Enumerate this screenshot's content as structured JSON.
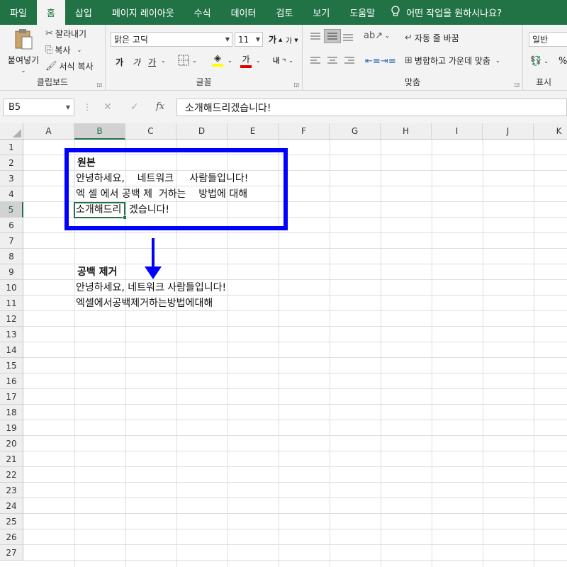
{
  "menu": {
    "tabs": [
      "파일",
      "홈",
      "삽입",
      "페이지 레이아웃",
      "수식",
      "데이터",
      "검토",
      "보기",
      "도움말"
    ],
    "active_tab": "홈",
    "tell_me": "어떤 작업을 원하시나요?"
  },
  "ribbon": {
    "clipboard": {
      "paste": "붙여넣기",
      "cut": "잘라내기",
      "copy": "복사",
      "format_painter": "서식 복사",
      "label": "클립보드"
    },
    "font": {
      "name": "맑은 고딕",
      "size": "11",
      "bold": "가",
      "italic": "가",
      "underline": "가",
      "font_color": "가",
      "label": "글꼴"
    },
    "alignment": {
      "wrap_text": "자동 줄 바꿈",
      "merge_center": "병합하고 가운데 맞춤",
      "label": "맞춤"
    },
    "number": {
      "format": "일반",
      "label": "표시"
    }
  },
  "formula_bar": {
    "name_box": "B5",
    "fx": "fx",
    "content": "소개해드리겠습니다!"
  },
  "columns": [
    "A",
    "B",
    "C",
    "D",
    "E",
    "F",
    "G",
    "H",
    "I",
    "J",
    "K"
  ],
  "rows": [
    "1",
    "2",
    "3",
    "4",
    "5",
    "6",
    "7",
    "8",
    "9",
    "10",
    "11",
    "12",
    "13",
    "14",
    "15",
    "16",
    "17",
    "18",
    "19",
    "20",
    "21",
    "22",
    "23",
    "24",
    "25",
    "26",
    "27"
  ],
  "active_cell": "B5",
  "cells": {
    "original_title": "원본",
    "original_line1": "안녕하세요,    네트워크     사람들입니다!",
    "original_line2": "엑 셀 에서 공백 제  거하는    방법에 대해",
    "original_line3a": "소개해드리",
    "original_line3b": "겠습니다!",
    "removed_title": "공백 제거",
    "removed_line1": "안녕하세요, 네트워크 사람들입니다!",
    "removed_line2": "엑셀에서공백제거하는방법에대해"
  },
  "colors": {
    "excel_green": "#217346",
    "annotation_blue": "#0000ff"
  }
}
